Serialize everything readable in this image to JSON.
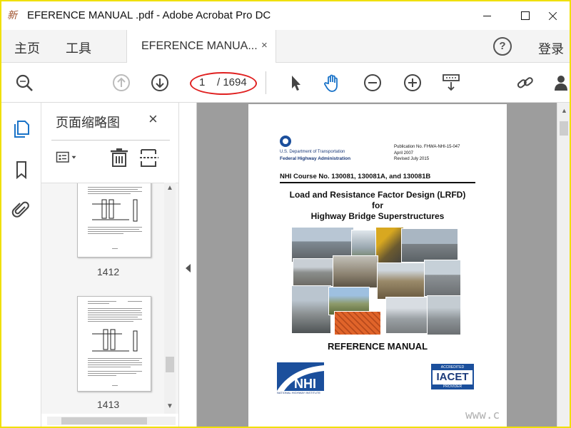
{
  "window": {
    "title": "EFERENCE MANUAL .pdf - Adobe Acrobat Pro DC",
    "logo_glyph": "新闻"
  },
  "menubar": {
    "home": "主页",
    "tools": "工具",
    "doc_tab": "EFERENCE MANUA...",
    "doc_tab_close": "×",
    "help": "?",
    "login": "登录"
  },
  "toolbar": {
    "current_page": "1",
    "total_pages": "/ 1694",
    "icons": [
      "search-icon",
      "page-up-icon",
      "page-down-icon",
      "select-arrow-icon",
      "hand-icon",
      "zoom-out-icon",
      "zoom-in-icon",
      "marquee-zoom-icon",
      "share-link-icon",
      "user-icon"
    ]
  },
  "sidebar": {
    "panel_title": "页面缩略图",
    "panel_close": "×",
    "thumbnails": [
      {
        "label": "1412"
      },
      {
        "label": "1413"
      }
    ]
  },
  "document": {
    "dept": "U.S. Department of Transportation",
    "agency": "Federal Highway Administration",
    "pub_no": "Publication No. FHWA-NHI-15-047",
    "pub_date": "April 2007",
    "revised": "Revised July 2015",
    "course": "NHI Course No. 130081, 130081A, and 130081B",
    "title_line1": "Load and Resistance Factor Design (LRFD)",
    "title_line2": "for",
    "title_line3": "Highway Bridge Superstructures",
    "reference": "REFERENCE MANUAL",
    "nhi_caption": "NATIONAL HIGHWAY INSTITUTE",
    "iacet_top": "ACCREDITED",
    "iacet_name": "IACET",
    "iacet_bottom": "PROVIDER"
  },
  "colors": {
    "highlight_ring": "#e02020",
    "frame_border": "#f0e000",
    "doc_background": "#9d9d9d",
    "accent_blue": "#1b4f9c"
  },
  "watermark": "www.c"
}
